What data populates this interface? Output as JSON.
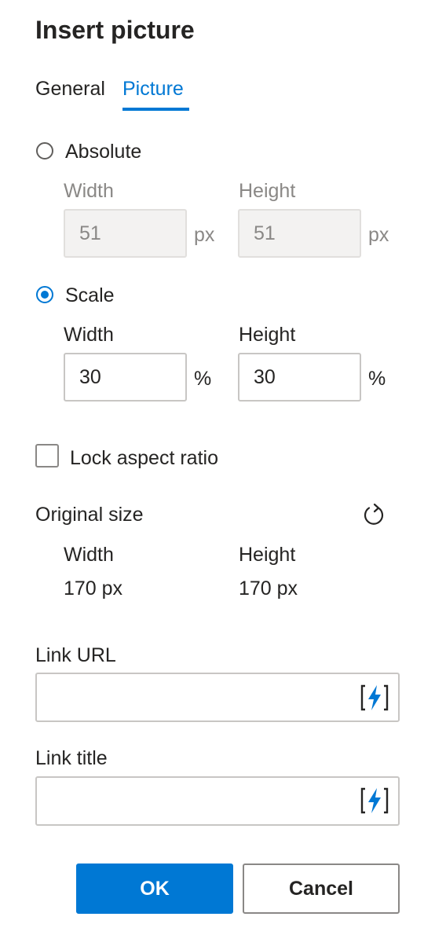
{
  "dialog": {
    "title": "Insert picture",
    "tabs": [
      {
        "label": "General",
        "active": false
      },
      {
        "label": "Picture",
        "active": true
      }
    ]
  },
  "absolute": {
    "label": "Absolute",
    "selected": false,
    "width_label": "Width",
    "height_label": "Height",
    "width_value": "51",
    "height_value": "51",
    "unit": "px"
  },
  "scale": {
    "label": "Scale",
    "selected": true,
    "width_label": "Width",
    "height_label": "Height",
    "width_value": "30",
    "height_value": "30",
    "unit": "%"
  },
  "lock_aspect": {
    "label": "Lock aspect ratio",
    "checked": false
  },
  "original_size": {
    "label": "Original size",
    "width_label": "Width",
    "height_label": "Height",
    "width_value": "170 px",
    "height_value": "170 px",
    "reset_icon": "refresh-icon"
  },
  "link_url": {
    "label": "Link URL",
    "value": "",
    "icon": "dynamic-content-icon"
  },
  "link_title": {
    "label": "Link title",
    "value": "",
    "icon": "dynamic-content-icon"
  },
  "buttons": {
    "ok": "OK",
    "cancel": "Cancel"
  },
  "colors": {
    "accent": "#0078d4",
    "text": "#252423",
    "disabled_text": "#8a8886"
  }
}
